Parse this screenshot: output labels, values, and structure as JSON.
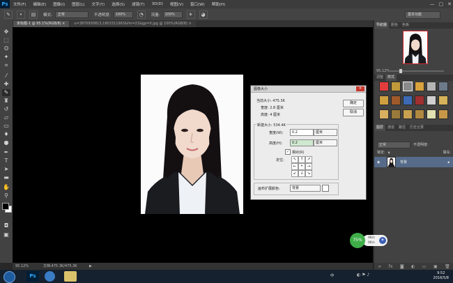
{
  "app": {
    "logo": "Ps"
  },
  "menu": [
    "文件(F)",
    "编辑(E)",
    "图像(I)",
    "图层(L)",
    "文字(Y)",
    "选择(S)",
    "滤镜(T)",
    "3D(D)",
    "视图(V)",
    "窗口(W)",
    "帮助(H)"
  ],
  "window_controls": {
    "minimize": "—",
    "maximize": "▢",
    "close": "✕"
  },
  "options": {
    "mode_label": "模式:",
    "mode_value": "正常",
    "opacity_label": "不透明度:",
    "opacity_value": "100%",
    "flow_label": "流量:",
    "flow_value": "100%",
    "workspace": "基本功能"
  },
  "tabs": [
    {
      "label": "未标题-1 @ 95.1%(RGB/8) ×",
      "active": true
    },
    {
      "label": "u=3870930813,1801511963&fm=21&gp=0.jpg @ 100%(RGB/8) ×",
      "active": false
    }
  ],
  "status": {
    "zoom": "95.12%",
    "doc": "文档:475.3K/475.3K"
  },
  "panels": {
    "top_tabs": [
      "导航器",
      "颜色",
      "色板"
    ],
    "nav_zoom": "95.12%",
    "style_tabs": [
      "调整",
      "样式"
    ],
    "layers_tabs": [
      "图层",
      "通道",
      "路径",
      "历史记录"
    ],
    "blend_mode": "正常",
    "opacity_label": "不透明度:",
    "lock_label": "锁定:",
    "fill_label": "填充:",
    "layer_name": "背景"
  },
  "dialog": {
    "title": "图像大小",
    "current_size_label": "当前大小: 475.3K",
    "current_width": "宽度:  2.8 厘米",
    "current_height": "高度:  4 厘米",
    "ok": "确定",
    "cancel": "取消",
    "new_size_label": "新建大小: 534.4K",
    "width_label": "宽度(W):",
    "width_value": "0.2",
    "width_unit": "厘米",
    "height_label": "高度(H):",
    "height_value": "0.2",
    "height_unit": "厘米",
    "relative_label": "相对(R)",
    "anchor_label": "定位:",
    "extension_label": "画布扩展颜色:",
    "extension_value": "背景"
  },
  "widget": {
    "percent": "75%",
    "up": "0K/s",
    "down": "0K/s"
  },
  "taskbar": {
    "lang": "中",
    "time": "9:52",
    "date": "2016/5/8"
  },
  "colors": {
    "dialog_close": "#c8362b",
    "layer_selected": "#566b8a",
    "widget_green": "#3fae49"
  },
  "icons": [
    "move-icon",
    "marquee-icon",
    "lasso-icon",
    "magic-wand-icon",
    "crop-icon",
    "eyedropper-icon",
    "healing-icon",
    "brush-icon",
    "stamp-icon",
    "history-brush-icon",
    "eraser-icon",
    "gradient-icon",
    "blur-icon",
    "dodge-icon",
    "pen-icon",
    "type-icon",
    "path-select-icon",
    "shape-icon",
    "hand-icon",
    "zoom-icon"
  ]
}
